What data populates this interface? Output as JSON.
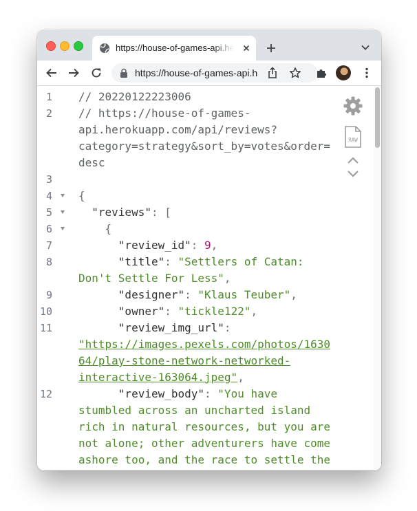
{
  "browser": {
    "tab_title": "https://house-of-games-api.herokuapp.com/api/reviews?category=strategy&sort_by=votes&order=desc",
    "address_bar_text": "https://house-of-games-api.herokuapp.com/api/reviews?category=strategy&sort_by=votes&order=desc",
    "traffic_light_colors": [
      "#fe5f57",
      "#febc2e",
      "#28c840"
    ]
  },
  "viewer": {
    "raw_label": "RAW",
    "lines": [
      {
        "n": "1",
        "fold": false,
        "tokens": [
          {
            "t": "// 20220122223006",
            "c": "com"
          }
        ]
      },
      {
        "n": "2",
        "fold": false,
        "tokens": [
          {
            "t": "// https://house-of-games-",
            "c": "com"
          }
        ]
      },
      {
        "n": "",
        "fold": false,
        "tokens": [
          {
            "t": "api.herokuapp.com/api/reviews?",
            "c": "com"
          }
        ]
      },
      {
        "n": "",
        "fold": false,
        "tokens": [
          {
            "t": "category=strategy&sort_by=votes&order=",
            "c": "com"
          }
        ]
      },
      {
        "n": "",
        "fold": false,
        "tokens": [
          {
            "t": "desc",
            "c": "com"
          }
        ]
      },
      {
        "n": "3",
        "fold": false,
        "tokens": []
      },
      {
        "n": "4",
        "fold": true,
        "tokens": [
          {
            "t": "{",
            "c": "pun"
          }
        ]
      },
      {
        "n": "5",
        "fold": true,
        "tokens": [
          {
            "t": "  \"reviews\"",
            "c": "key"
          },
          {
            "t": ": [",
            "c": "pun"
          }
        ]
      },
      {
        "n": "6",
        "fold": true,
        "tokens": [
          {
            "t": "    {",
            "c": "pun"
          }
        ]
      },
      {
        "n": "7",
        "fold": false,
        "tokens": [
          {
            "t": "      \"review_id\"",
            "c": "key"
          },
          {
            "t": ": ",
            "c": "pun"
          },
          {
            "t": "9",
            "c": "num"
          },
          {
            "t": ",",
            "c": "pun"
          }
        ]
      },
      {
        "n": "8",
        "fold": false,
        "tokens": [
          {
            "t": "      \"title\"",
            "c": "key"
          },
          {
            "t": ": ",
            "c": "pun"
          },
          {
            "t": "\"Settlers of Catan:",
            "c": "str"
          }
        ]
      },
      {
        "n": "",
        "fold": false,
        "tokens": [
          {
            "t": "Don't Settle For Less\"",
            "c": "str"
          },
          {
            "t": ",",
            "c": "pun"
          }
        ]
      },
      {
        "n": "9",
        "fold": false,
        "tokens": [
          {
            "t": "      \"designer\"",
            "c": "key"
          },
          {
            "t": ": ",
            "c": "pun"
          },
          {
            "t": "\"Klaus Teuber\"",
            "c": "str"
          },
          {
            "t": ",",
            "c": "pun"
          }
        ]
      },
      {
        "n": "10",
        "fold": false,
        "tokens": [
          {
            "t": "      \"owner\"",
            "c": "key"
          },
          {
            "t": ": ",
            "c": "pun"
          },
          {
            "t": "\"tickle122\"",
            "c": "str"
          },
          {
            "t": ",",
            "c": "pun"
          }
        ]
      },
      {
        "n": "11",
        "fold": false,
        "tokens": [
          {
            "t": "      \"review_img_url\"",
            "c": "key"
          },
          {
            "t": ":",
            "c": "pun"
          }
        ]
      },
      {
        "n": "",
        "fold": false,
        "tokens": [
          {
            "t": "\"https://images.pexels.com/photos/1630",
            "c": "url"
          }
        ]
      },
      {
        "n": "",
        "fold": false,
        "tokens": [
          {
            "t": "64/play-stone-network-networked-",
            "c": "url"
          }
        ]
      },
      {
        "n": "",
        "fold": false,
        "tokens": [
          {
            "t": "interactive-163064.jpeg\"",
            "c": "url"
          },
          {
            "t": ",",
            "c": "pun"
          }
        ]
      },
      {
        "n": "12",
        "fold": false,
        "tokens": [
          {
            "t": "      \"review_body\"",
            "c": "key"
          },
          {
            "t": ": ",
            "c": "pun"
          },
          {
            "t": "\"You have",
            "c": "str"
          }
        ]
      },
      {
        "n": "",
        "fold": false,
        "tokens": [
          {
            "t": "stumbled across an uncharted island",
            "c": "str"
          }
        ]
      },
      {
        "n": "",
        "fold": false,
        "tokens": [
          {
            "t": "rich in natural resources, but you are",
            "c": "str"
          }
        ]
      },
      {
        "n": "",
        "fold": false,
        "tokens": [
          {
            "t": "not alone; other adventurers have come",
            "c": "str"
          }
        ]
      },
      {
        "n": "",
        "fold": false,
        "tokens": [
          {
            "t": "ashore too, and the race to settle the",
            "c": "str"
          }
        ]
      }
    ]
  }
}
